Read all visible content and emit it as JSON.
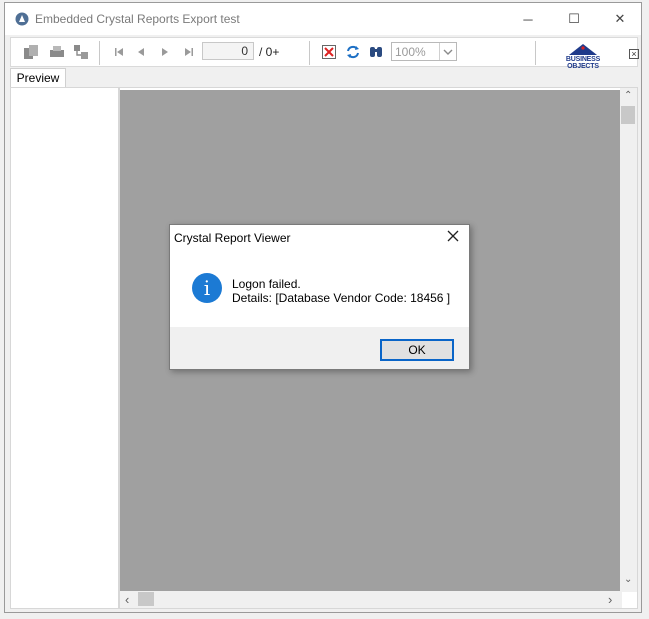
{
  "window": {
    "title": "Embedded Crystal Reports Export test",
    "controls": {
      "minimize": "─",
      "maximize": "☐",
      "close": "✕"
    }
  },
  "toolbar": {
    "page_current": "0",
    "page_total": "/ 0+",
    "zoom": "100%",
    "logo_text": "BUSINESS OBJECTS"
  },
  "tabs": [
    "Preview"
  ],
  "colors": {
    "preview_bg": "#a0a0a0",
    "focus_border": "#0a65c8",
    "info_icon": "#1c7ad4",
    "logo_text": "#1f3a8a"
  },
  "dialog": {
    "title": "Crystal Report Viewer",
    "message_line1": "Logon failed.",
    "message_line2": "Details:  [Database Vendor Code: 18456 ]",
    "ok_label": "OK",
    "icon": "info-icon"
  },
  "scroll": {
    "up": "⌃",
    "down": "⌄",
    "left": "‹",
    "right": "›"
  }
}
